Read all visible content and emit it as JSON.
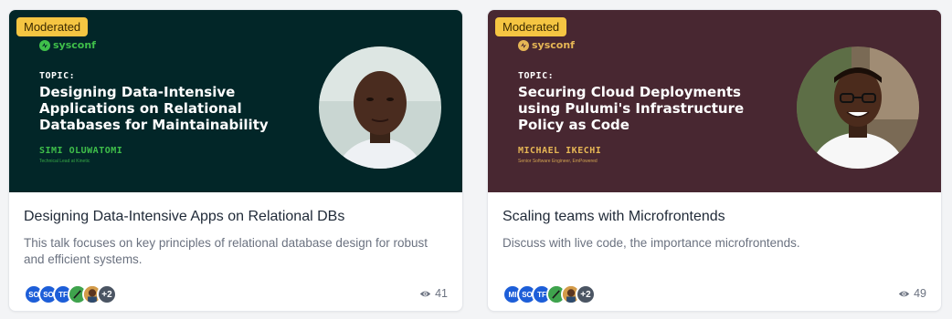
{
  "cards": [
    {
      "badge": "Moderated",
      "brand": "sysconf",
      "banner_bg": "#022628",
      "accent": "#3fbf4a",
      "topic_label": "TOPIC:",
      "topic_title": "Designing Data-Intensive Applications on Relational Databases for Maintainability",
      "speaker_name": "SIMI OLUWATOMI",
      "speaker_role": "Technical Lead at Kinetic",
      "title": "Designing Data-Intensive Apps on Relational DBs",
      "description": "This talk focuses on key principles of relational database design for robust and efficient systems.",
      "avatars": [
        "SO",
        "SO",
        "TF",
        "",
        "",
        "+2"
      ],
      "views": "41",
      "view_icon": "eye-icon"
    },
    {
      "badge": "Moderated",
      "brand": "sysconf",
      "banner_bg": "#482731",
      "accent": "#e6b655",
      "topic_label": "TOPIC:",
      "topic_title": "Securing Cloud Deployments using Pulumi's Infrastructure Policy as Code",
      "speaker_name": "MICHAEL IKECHI",
      "speaker_role": "Senior Software Engineer, EmPowered",
      "title": "Scaling teams with Microfrontends",
      "description": "Discuss with live code, the importance microfrontends.",
      "avatars": [
        "MI",
        "SO",
        "TF",
        "",
        "",
        "+2"
      ],
      "views": "49",
      "view_icon": "eye-icon"
    }
  ]
}
